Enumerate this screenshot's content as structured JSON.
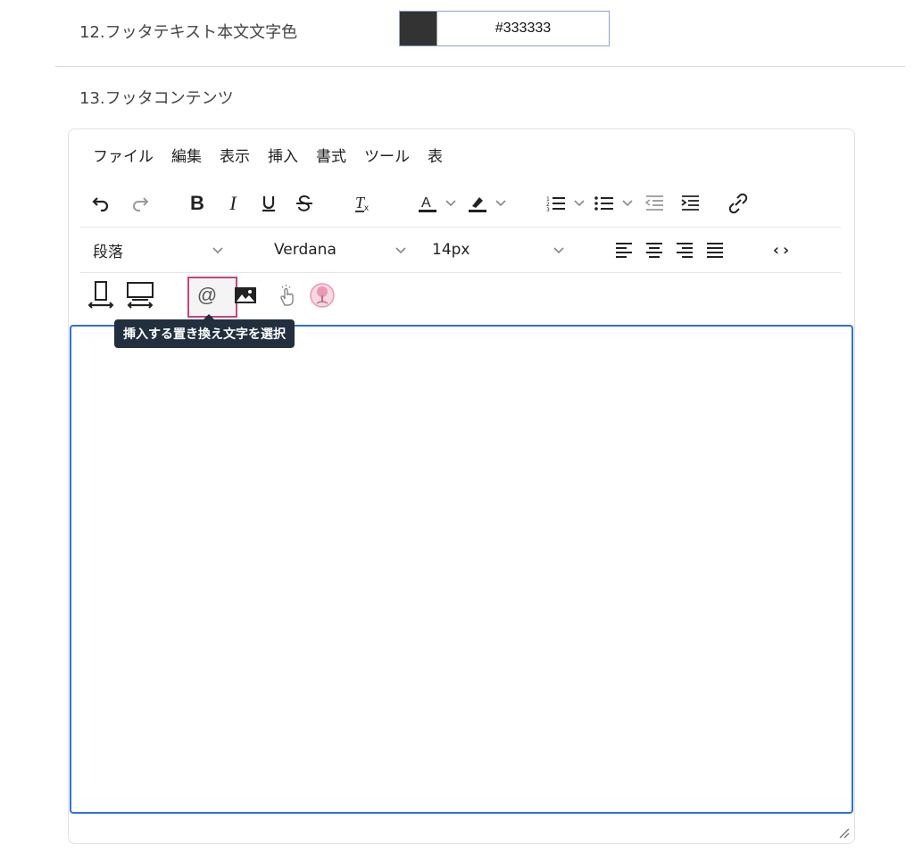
{
  "section12": {
    "label": "12.フッタテキスト本文文字色",
    "color_value": "#333333",
    "swatch_color": "#333333"
  },
  "section13": {
    "label": "13.フッタコンテンツ"
  },
  "menubar": [
    "ファイル",
    "編集",
    "表示",
    "挿入",
    "書式",
    "ツール",
    "表"
  ],
  "toolbar": {
    "block_format": "段落",
    "font_family": "Verdana",
    "font_size": "14px",
    "tooltip": "挿入する置き換え文字を選択"
  },
  "colors": {
    "focus_border": "#2f6fe0",
    "highlight_border": "#c2467d",
    "tooltip_bg": "#222f3e"
  }
}
